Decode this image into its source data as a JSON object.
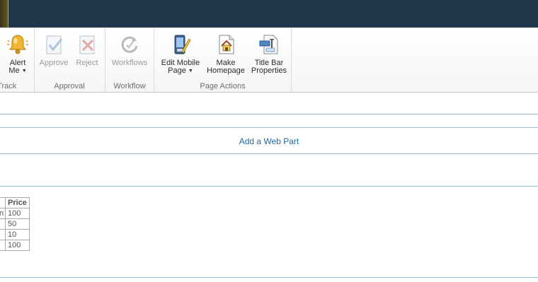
{
  "ribbon": {
    "groups": {
      "share_track": {
        "label": "& Track",
        "alert_line1": "Alert",
        "alert_line2": "Me"
      },
      "approval": {
        "label": "Approval",
        "approve": "Approve",
        "reject": "Reject"
      },
      "workflow": {
        "label": "Workflow",
        "workflows": "Workflows"
      },
      "page_actions": {
        "label": "Page Actions",
        "edit_mobile_line1": "Edit Mobile",
        "edit_mobile_line2": "Page",
        "make_home_line1": "Make",
        "make_home_line2": "Homepage",
        "title_bar_line1": "Title Bar",
        "title_bar_line2": "Properties"
      }
    }
  },
  "webpart_zone": {
    "add_label": "Add a Web Part"
  },
  "table": {
    "header": [
      "",
      "Price"
    ],
    "rows": [
      [
        "n",
        "100"
      ],
      [
        "",
        "50"
      ],
      [
        "",
        "10"
      ],
      [
        "",
        "100"
      ]
    ]
  },
  "colors": {
    "topbar": "#21354b",
    "link": "#1f6aa8",
    "divider": "#8fc0db"
  },
  "icons": [
    "bell-icon",
    "approve-icon",
    "reject-icon",
    "workflows-icon",
    "mobile-page-icon",
    "homepage-icon",
    "title-bar-icon"
  ]
}
